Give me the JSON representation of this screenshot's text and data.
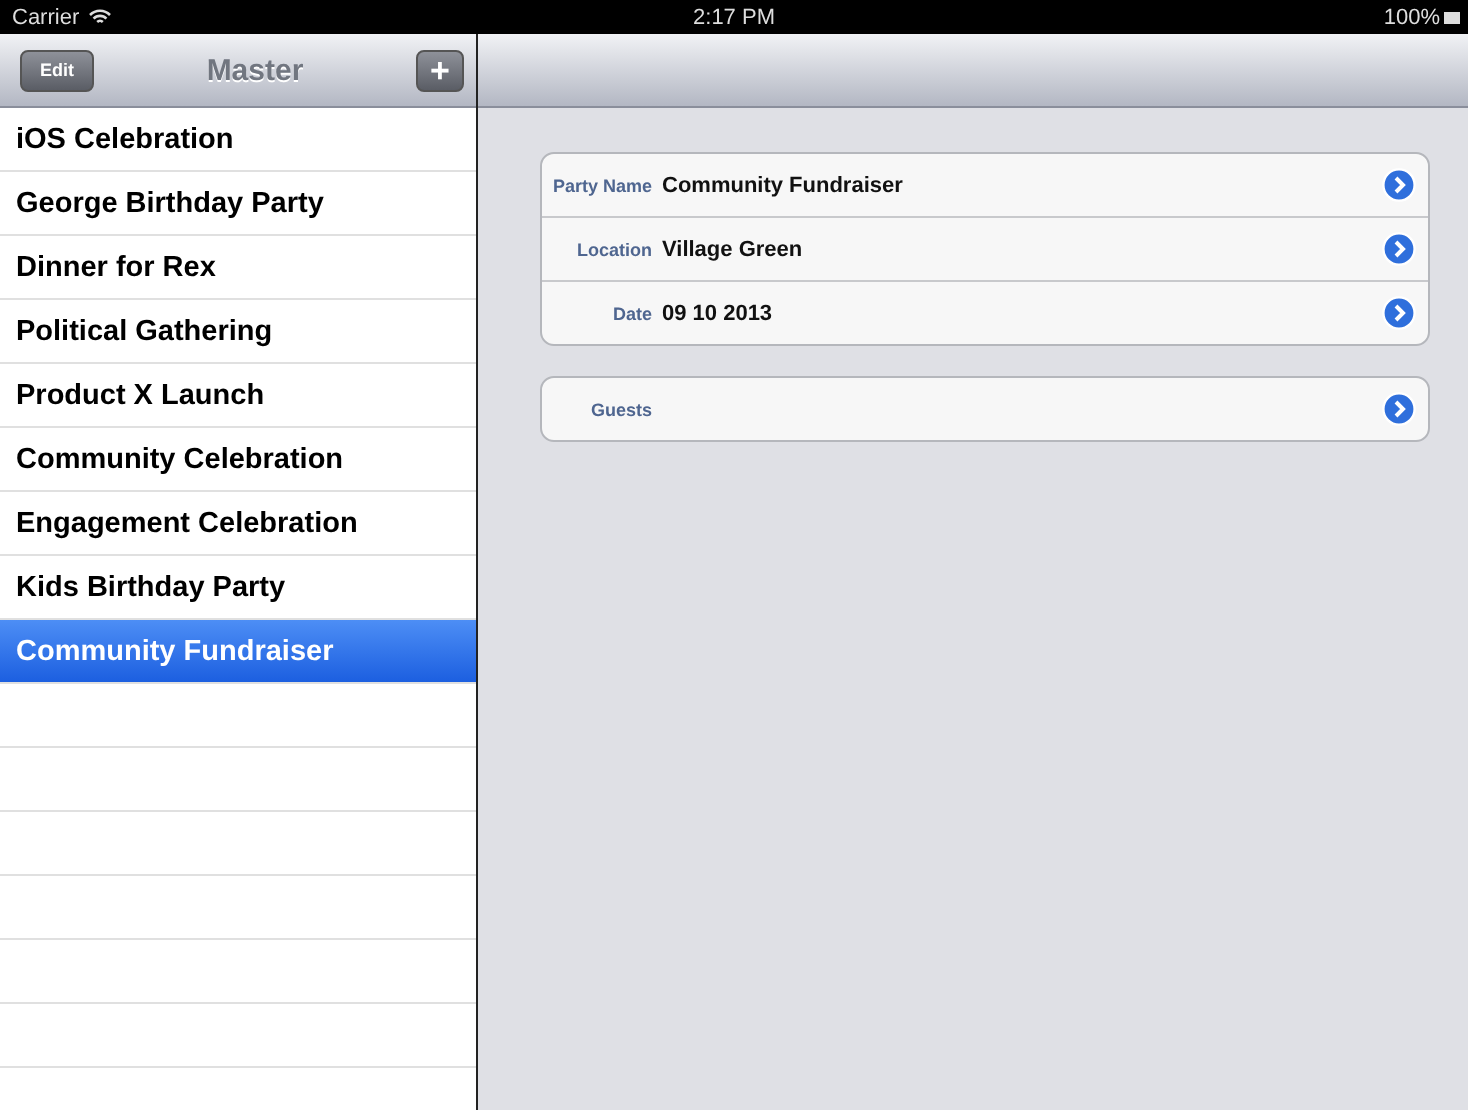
{
  "status_bar": {
    "carrier": "Carrier",
    "time": "2:17 PM",
    "battery": "100%"
  },
  "master": {
    "title": "Master",
    "edit_button": "Edit",
    "add_button": "+",
    "items": [
      {
        "label": "iOS Celebration",
        "selected": false
      },
      {
        "label": "George Birthday Party",
        "selected": false
      },
      {
        "label": "Dinner for Rex",
        "selected": false
      },
      {
        "label": "Political Gathering",
        "selected": false
      },
      {
        "label": "Product X Launch",
        "selected": false
      },
      {
        "label": "Community Celebration",
        "selected": false
      },
      {
        "label": "Engagement Celebration",
        "selected": false
      },
      {
        "label": "Kids Birthday Party",
        "selected": false
      },
      {
        "label": "Community Fundraiser",
        "selected": true
      }
    ]
  },
  "detail": {
    "groups": [
      [
        {
          "label": "Party Name",
          "value": "Community Fundraiser"
        },
        {
          "label": "Location",
          "value": "Village Green"
        },
        {
          "label": "Date",
          "value": "09 10 2013"
        }
      ],
      [
        {
          "label": "Guests"
        }
      ]
    ]
  }
}
